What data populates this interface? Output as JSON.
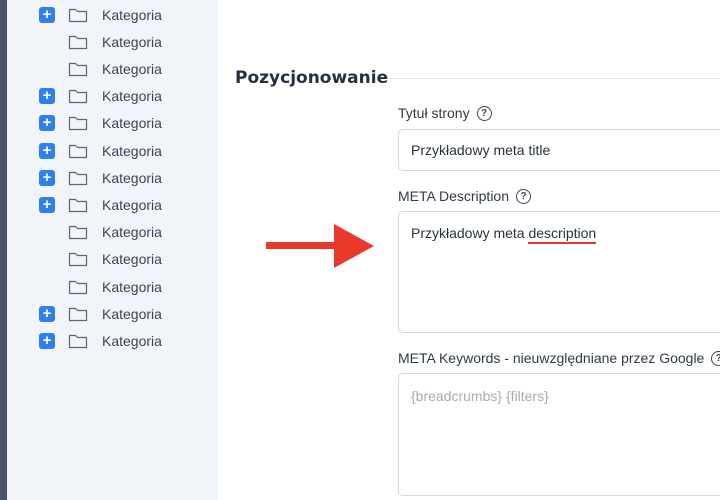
{
  "sidebar": {
    "items": [
      {
        "label": "Kategoria",
        "expandable": true
      },
      {
        "label": "Kategoria",
        "expandable": false
      },
      {
        "label": "Kategoria",
        "expandable": false
      },
      {
        "label": "Kategoria",
        "expandable": true
      },
      {
        "label": "Kategoria",
        "expandable": true
      },
      {
        "label": "Kategoria",
        "expandable": true
      },
      {
        "label": "Kategoria",
        "expandable": true
      },
      {
        "label": "Kategoria",
        "expandable": true
      },
      {
        "label": "Kategoria",
        "expandable": false
      },
      {
        "label": "Kategoria",
        "expandable": false
      },
      {
        "label": "Kategoria",
        "expandable": false
      },
      {
        "label": "Kategoria",
        "expandable": true
      },
      {
        "label": "Kategoria",
        "expandable": true
      }
    ]
  },
  "section": {
    "title": "Pozycjonowanie",
    "page_title_label": "Tytuł strony",
    "page_title_value": "Przykładowy meta title",
    "meta_description_label": "META Description",
    "meta_description_prefix": "Przykładowy meta ",
    "meta_description_underlined": "description",
    "meta_keywords_label": "META Keywords - nieuwzględniane przez Google",
    "meta_keywords_placeholder": "{breadcrumbs} {filters}"
  },
  "icons": {
    "help": "?",
    "expand": "+"
  },
  "colors": {
    "accent": "#2f80ed",
    "arrow": "#e8392a",
    "sidebar_bg": "#f1f5f9"
  }
}
